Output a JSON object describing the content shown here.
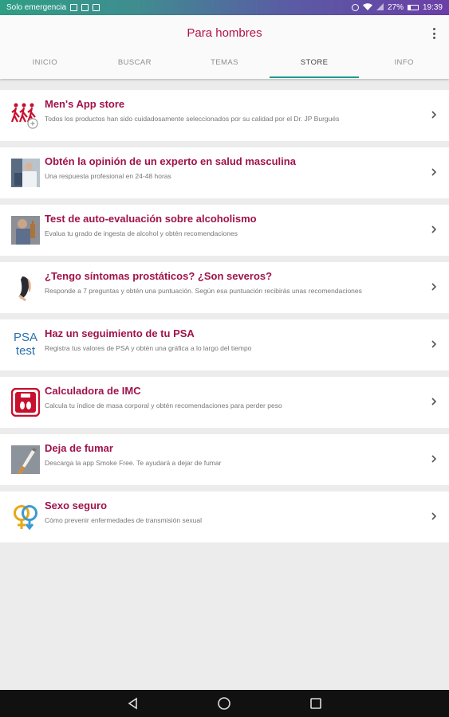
{
  "status_bar": {
    "carrier": "Solo emergencia",
    "battery": "27%",
    "time": "19:39"
  },
  "app": {
    "title": "Para hombres"
  },
  "tabs": [
    {
      "label": "INICIO"
    },
    {
      "label": "BUSCAR"
    },
    {
      "label": "TEMAS"
    },
    {
      "label": "STORE"
    },
    {
      "label": "INFO"
    }
  ],
  "active_tab": "STORE",
  "accent_color": "#a0124a",
  "tab_indicator_color": "#1a9c8c",
  "items": [
    {
      "icon": "running-men-icon",
      "title": "Men's App store",
      "subtitle": "Todos los productos han sido cuidadosamente seleccionados por su calidad por el Dr. JP Burgués"
    },
    {
      "icon": "doctor-photo-icon",
      "title": "Obtén la opinión de un experto en salud masculina",
      "subtitle": "Una respuesta profesional en 24-48 horas"
    },
    {
      "icon": "alcohol-photo-icon",
      "title": "Test de auto-evaluación sobre alcoholismo",
      "subtitle": "Evalua tu grado de ingesta de alcohol y obtén recomendaciones"
    },
    {
      "icon": "prostate-icon",
      "title": "¿Tengo síntomas prostáticos? ¿Son severos?",
      "subtitle": "Responde a 7 preguntas y obtén una puntuación. Según esa puntuación recibirás unas recomendaciones"
    },
    {
      "icon": "psa-test-icon",
      "icon_text_1": "PSA",
      "icon_text_2": "test",
      "title": "Haz un seguimiento de tu PSA",
      "subtitle": "Registra tus valores de PSA y obtén una gráfica a lo largo del tiempo"
    },
    {
      "icon": "scale-icon",
      "title": "Calculadora de IMC",
      "subtitle": "Calcula tu índice de masa corporal y obtén recomendaciones para perder peso"
    },
    {
      "icon": "cigarette-icon",
      "title": "Deja de fumar",
      "subtitle": "Descarga la app Smoke Free. Te ayudará a dejar de fumar"
    },
    {
      "icon": "gender-symbols-icon",
      "title": "Sexo seguro",
      "subtitle": "Cómo prevenir enfermedades de transmisión sexual"
    }
  ]
}
